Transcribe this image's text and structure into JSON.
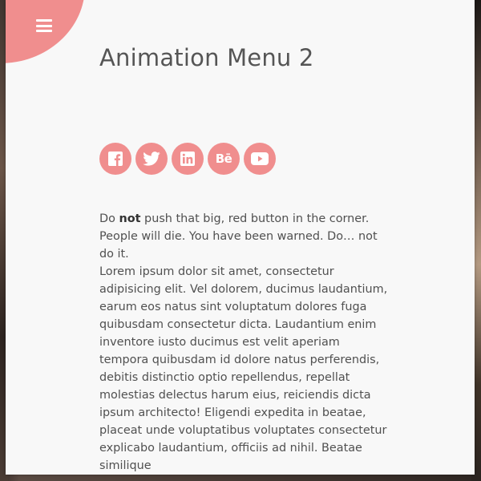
{
  "page": {
    "title": "Animation Menu 2",
    "accent_color": "#f08e8e",
    "panel_background": "#f8f8f8"
  },
  "menu": {
    "icon": "hamburger-icon"
  },
  "socials": [
    {
      "name": "facebook",
      "icon": "facebook-icon"
    },
    {
      "name": "twitter",
      "icon": "twitter-icon"
    },
    {
      "name": "linkedin",
      "icon": "linkedin-icon"
    },
    {
      "name": "behance",
      "icon": "behance-icon",
      "glyph": "Bē"
    },
    {
      "name": "youtube",
      "icon": "youtube-icon"
    }
  ],
  "intro": {
    "before": "Do ",
    "emphasis": "not",
    "after": " push that big, red button in the corner. People will die. You have been warned. Do… not do it."
  },
  "body_text": "Lorem ipsum dolor sit amet, consectetur adipisicing elit. Vel dolorem, ducimus laudantium, earum eos natus sint voluptatum dolores fuga quibusdam consectetur dicta. Laudantium enim inventore iusto ducimus est velit aperiam tempora quibusdam id dolore natus perferendis, debitis distinctio optio repellendus, repellat molestias delectus harum eius, reiciendis dicta ipsum architecto! Eligendi expedita in beatae, placeat unde voluptatibus voluptates consectetur explicabo laudantium, officiis ad nihil. Beatae similique"
}
